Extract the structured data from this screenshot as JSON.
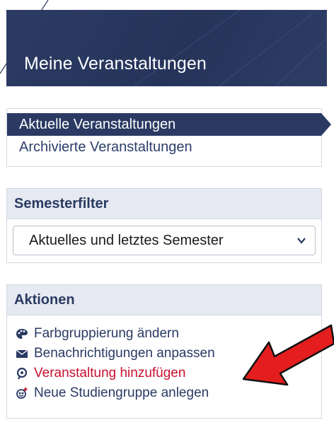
{
  "header": {
    "title": "Meine Veranstaltungen"
  },
  "nav": {
    "items": [
      {
        "label": "Aktuelle Veranstaltungen"
      },
      {
        "label": "Archivierte Veranstaltungen"
      }
    ]
  },
  "semester_filter": {
    "heading": "Semesterfilter",
    "selected": "Aktuelles und letztes Semester"
  },
  "actions": {
    "heading": "Aktionen",
    "items": [
      {
        "label": "Farbgruppierung ändern",
        "icon": "palette-icon"
      },
      {
        "label": "Benachrichtigungen anpassen",
        "icon": "envelope-icon"
      },
      {
        "label": "Veranstaltung hinzufügen",
        "icon": "add-course-icon"
      },
      {
        "label": "Neue Studiengruppe anlegen",
        "icon": "new-group-icon"
      }
    ]
  },
  "colors": {
    "brand": "#2a3a63",
    "highlight_red": "#c8102e",
    "arrow_red": "#e41e1e"
  }
}
